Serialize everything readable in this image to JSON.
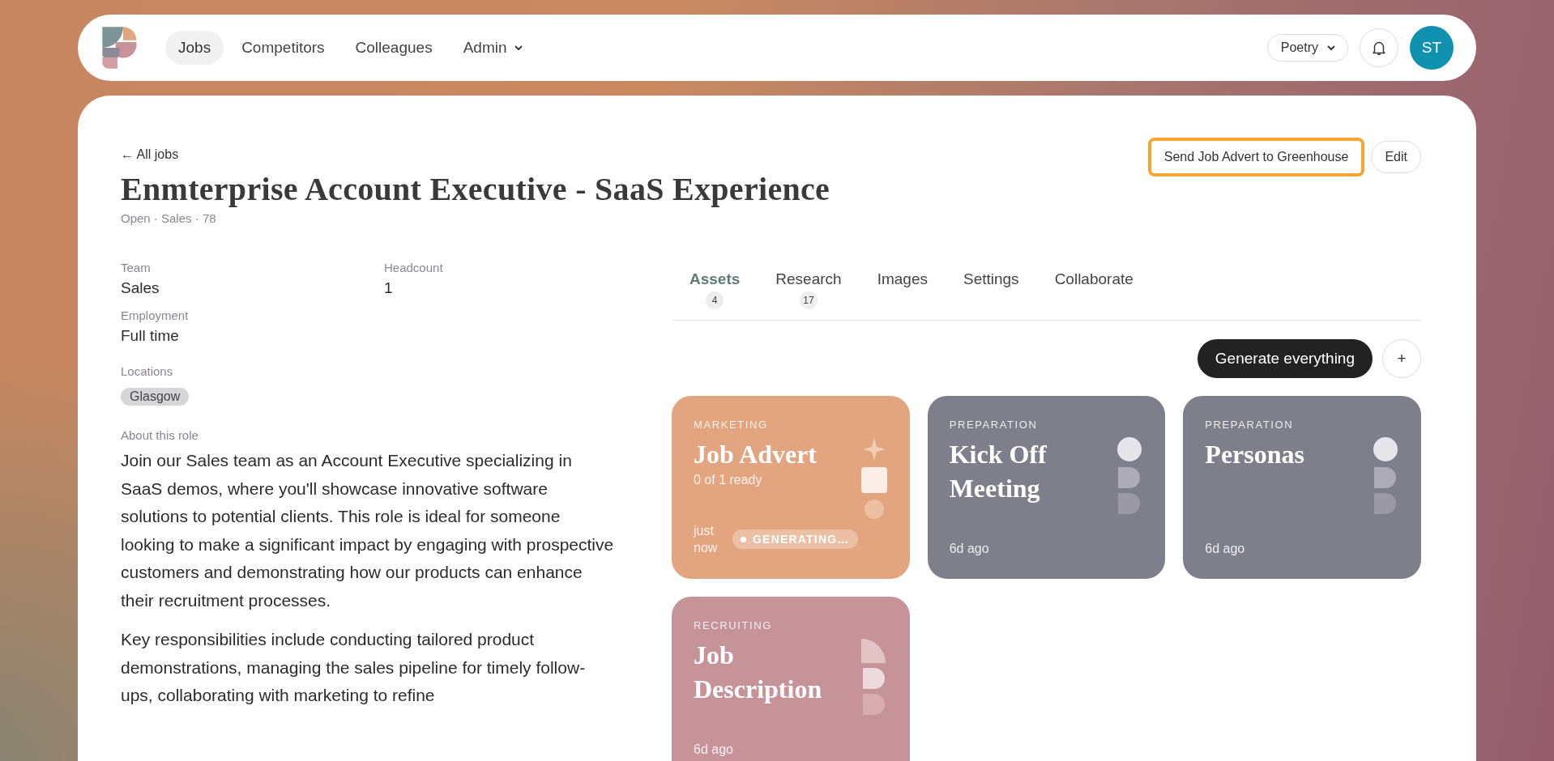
{
  "nav": {
    "items": [
      {
        "label": "Jobs",
        "selected": true,
        "dropdown": false
      },
      {
        "label": "Competitors",
        "selected": false,
        "dropdown": false
      },
      {
        "label": "Colleagues",
        "selected": false,
        "dropdown": false
      },
      {
        "label": "Admin",
        "selected": false,
        "dropdown": true
      }
    ],
    "workspace": "Poetry",
    "avatar": "ST"
  },
  "back_link": "← All jobs",
  "actions": [
    {
      "label": "Send Job Advert to Greenhouse",
      "focused": true
    },
    {
      "label": "Edit",
      "focused": false
    }
  ],
  "title": "Enmterprise Account Executive - SaaS Experience",
  "subtitle": "Open · Sales · 78",
  "details": [
    {
      "label": "Team",
      "value": "Sales"
    },
    {
      "label": "Headcount",
      "value": "1"
    },
    {
      "label": "Employment",
      "value": "Full time"
    }
  ],
  "locations": {
    "label": "Locations",
    "tags": [
      "Glasgow"
    ]
  },
  "about": {
    "label": "About this role",
    "paragraphs": [
      "Join our Sales team as an Account Executive specializing in SaaS demos, where you'll showcase innovative software solutions to potential clients. This role is ideal for someone looking to make a significant impact by engaging with prospective customers and demonstrating how our products can enhance their recruitment processes.",
      "Key responsibilities include conducting tailored product demonstrations, managing the sales pipeline for timely follow-ups, collaborating with marketing to refine"
    ]
  },
  "tabs": [
    {
      "label": "Assets",
      "count": "4",
      "selected": true
    },
    {
      "label": "Research",
      "count": "17",
      "selected": false
    },
    {
      "label": "Images",
      "selected": false
    },
    {
      "label": "Settings",
      "selected": false
    },
    {
      "label": "Collaborate",
      "selected": false
    }
  ],
  "generate_button": "Generate everything",
  "add_button": "+",
  "cards": [
    {
      "kind": "marketing",
      "category": "MARKETING",
      "title": "Job Advert",
      "subtitle": "0 of 1 ready",
      "time": "just now",
      "status": "GENERATING…",
      "color": "#e3a57f"
    },
    {
      "kind": "preparation",
      "category": "PREPARATION",
      "title": "Kick Off Meeting",
      "time": "6d ago",
      "color": "#7f7e8b"
    },
    {
      "kind": "preparation",
      "category": "PREPARATION",
      "title": "Personas",
      "time": "6d ago",
      "color": "#7f7e8b"
    },
    {
      "kind": "recruiting",
      "category": "RECRUITING",
      "title": "Job Description",
      "time": "6d ago",
      "color": "#c69398"
    }
  ]
}
